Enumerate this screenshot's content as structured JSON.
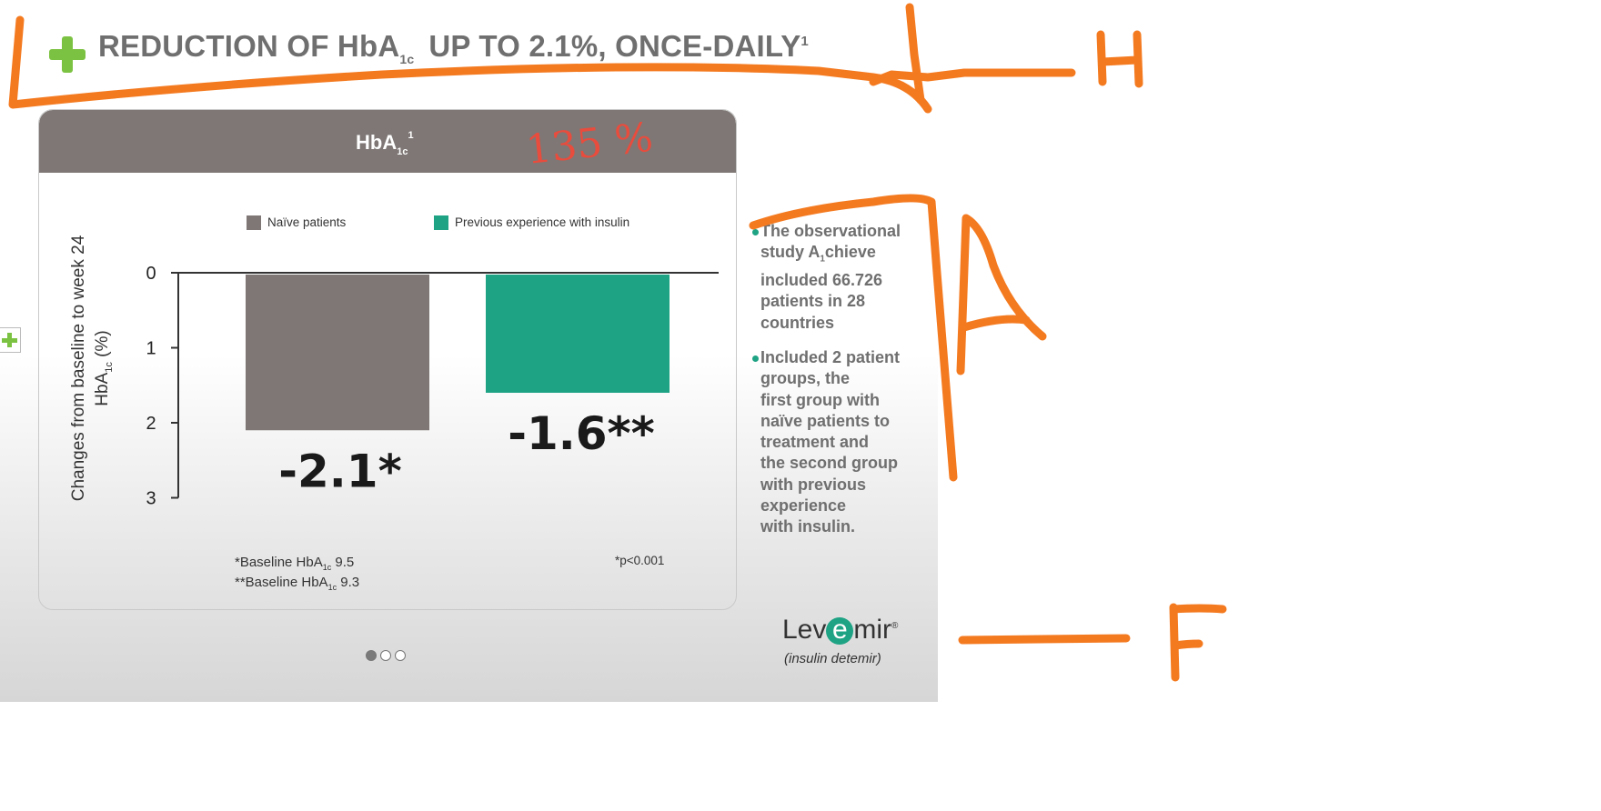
{
  "title": {
    "pre": "REDUCTION OF HbA",
    "sub": "1c",
    "post": "UP TO  2.1%, ONCE-DAILY",
    "sup": "1"
  },
  "card": {
    "title_main": "HbA",
    "title_sub": "1c",
    "title_sup": "1"
  },
  "chart_data": {
    "type": "bar",
    "categories": [
      "Naïve patients",
      "Previous experience with insulin"
    ],
    "values": [
      -2.1,
      -1.6
    ],
    "data_labels": [
      "-2.1*",
      "-1.6**"
    ],
    "colors": [
      "#7e7775",
      "#1ea384"
    ],
    "ylabel_line1": "Changes from baseline to week 24",
    "ylabel_line2_pre": "HbA",
    "ylabel_line2_sub": "1c",
    "ylabel_line2_post": " (%)",
    "yticks": [
      "0",
      "1",
      "2",
      "3"
    ],
    "ylim": [
      0,
      3
    ],
    "y_inverted": true,
    "legend": [
      {
        "label": "Naïve patients",
        "color": "#7e7775"
      },
      {
        "label": "Previous experience with insulin",
        "color": "#1ea384"
      }
    ],
    "legend_position": "top"
  },
  "footnotes": {
    "fn1_pre": "*Baseline HbA",
    "fn1_sub": "1c",
    "fn1_post": " 9.5",
    "fn2_pre": "**Baseline HbA",
    "fn2_sub": "1c",
    "fn2_post": " 9.3",
    "pvalue": "*p<0.001"
  },
  "bullets": [
    {
      "lines": [
        "The observational",
        "study A",
        "included 66.726",
        "patients in 28",
        "countries"
      ],
      "study_sub": "1",
      "study_post": "chieve"
    },
    {
      "lines": [
        "Included 2 patient",
        "groups, the",
        "first group with",
        "naïve patients to",
        "treatment and",
        "the second group",
        "with previous",
        "experience",
        "with insulin."
      ]
    }
  ],
  "logo": {
    "pre": "Lev",
    "e": "e",
    "post": "mir",
    "reg": "®",
    "sub": "(insulin detemir)"
  },
  "annotations": {
    "handwritten_percent": "135 %",
    "letter_h": "H",
    "letter_a": "A",
    "letter_f": "F"
  },
  "pager": {
    "count": 3,
    "active": 0
  },
  "colors": {
    "accent_green": "#1ea384",
    "bar_grey": "#7e7775",
    "pen_orange": "#f47a20",
    "header_grey": "#7e7775"
  }
}
